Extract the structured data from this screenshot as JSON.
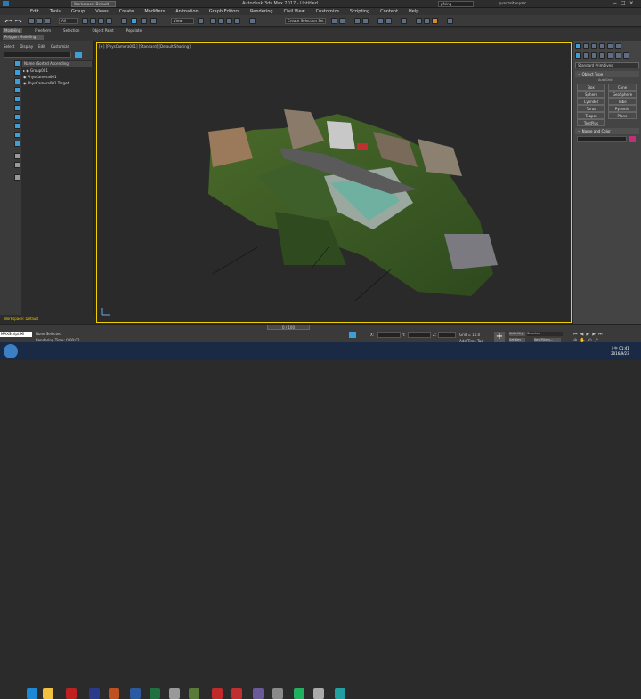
{
  "title": {
    "workspace": "Workspace: Default",
    "app": "Autodesk 3ds Max 2017 - Untitled",
    "search_value": "pfsing",
    "user": "quartzsitanparc..."
  },
  "menu": [
    "Edit",
    "Tools",
    "Group",
    "Views",
    "Create",
    "Modifiers",
    "Animation",
    "Graph Editors",
    "Rendering",
    "Civil View",
    "Customize",
    "Scripting",
    "Content",
    "Help"
  ],
  "toolbar": {
    "filter": "All",
    "view": "View",
    "selset": "Create Selection Set"
  },
  "ribbon": {
    "tabs": [
      "Modeling",
      "Freeform",
      "Selection",
      "Object Paint",
      "Populate"
    ],
    "sub": "Polygon Modeling"
  },
  "scene_explorer": {
    "menu": [
      "Select",
      "Display",
      "Edit",
      "Customize"
    ],
    "column": "Name (Sorted Ascending)",
    "items": [
      "Group001",
      "PhysCamera001",
      "PhysCamera001.Target"
    ],
    "workspace": "Workspace: Default"
  },
  "viewport": {
    "label": "[+] [PhysCamera001] [Standard] [Default Shading]",
    "frame": "0 / 100"
  },
  "command_panel": {
    "dropdown": "Standard Primitives",
    "rollout_object_type": "Object Type",
    "autogrid": "AutoGrid",
    "buttons": [
      "Box",
      "Cone",
      "Sphere",
      "GeoSphere",
      "Cylinder",
      "Tube",
      "Torus",
      "Pyramid",
      "Teapot",
      "Plane",
      "TextPlus"
    ],
    "rollout_name": "Name and Color",
    "object_color": "#c0307a"
  },
  "status": {
    "script": "MAXScript Mi",
    "selected": "None Selected",
    "render": "Rendering Time: 0:00:02",
    "x": "X:",
    "y": "Y:",
    "z": "Z:",
    "grid": "Grid = 10.0",
    "add_time_tag": "Add Time Tag",
    "autokey": "Auto Key",
    "setkey": "Set Key",
    "selected_mode": "Selected",
    "key_filters": "Key Filters..."
  },
  "clock": {
    "time": "上午 01:41",
    "date": "2016/9/23"
  },
  "colors": {
    "viewport_border": "#f0d000",
    "accent": "#3ba0d8"
  }
}
